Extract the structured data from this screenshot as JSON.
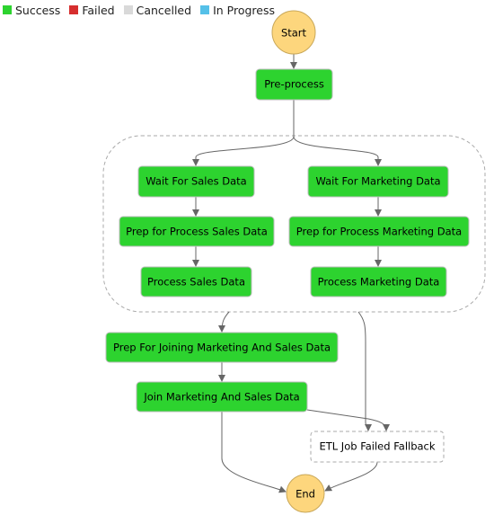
{
  "legend": [
    {
      "label": "Success",
      "color": "#2dd32f"
    },
    {
      "label": "Failed",
      "color": "#d62e2e"
    },
    {
      "label": "Cancelled",
      "color": "#d9d9d9"
    },
    {
      "label": "In Progress",
      "color": "#55c0e8"
    }
  ],
  "colors": {
    "success": "#2dd32f",
    "terminal": "#fdd67d",
    "not_run": "#ffffff",
    "edge": "#666666"
  },
  "nodes": {
    "start": {
      "label": "Start",
      "kind": "terminal"
    },
    "preprocess": {
      "label": "Pre-process",
      "status": "success"
    },
    "wait_sales": {
      "label": "Wait For Sales Data",
      "status": "success"
    },
    "wait_marketing": {
      "label": "Wait For Marketing Data",
      "status": "success"
    },
    "prep_sales": {
      "label": "Prep for Process Sales Data",
      "status": "success"
    },
    "prep_marketing": {
      "label": "Prep for Process Marketing Data",
      "status": "success"
    },
    "process_sales": {
      "label": "Process Sales Data",
      "status": "success"
    },
    "process_marketing": {
      "label": "Process Marketing Data",
      "status": "success"
    },
    "prep_join": {
      "label": "Prep For Joining Marketing And Sales Data",
      "status": "success"
    },
    "join": {
      "label": "Join Marketing And Sales Data",
      "status": "success"
    },
    "etl_fallback": {
      "label": "ETL Job Failed Fallback",
      "status": "not_run"
    },
    "end": {
      "label": "End",
      "kind": "terminal"
    }
  }
}
